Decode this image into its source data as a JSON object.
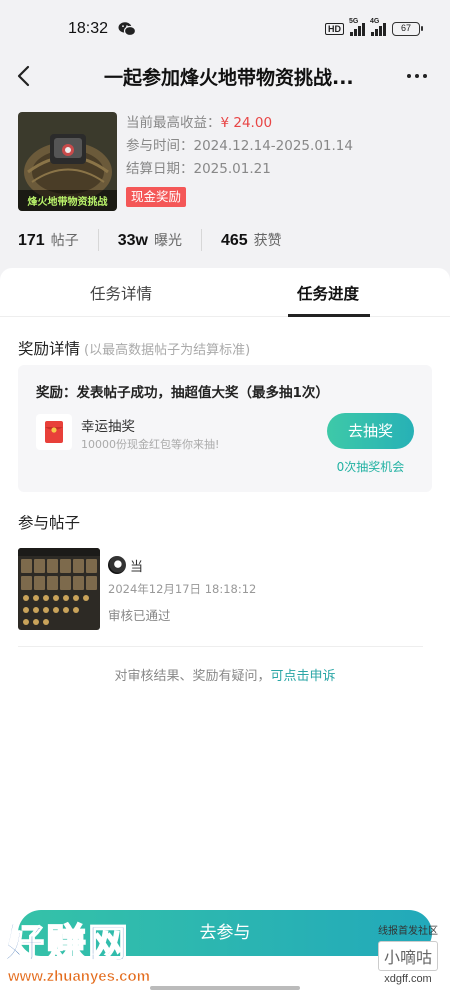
{
  "status_bar": {
    "time": "18:32",
    "hd": "HD",
    "net1": "5G",
    "net2": "4G",
    "battery": "67"
  },
  "nav": {
    "title": "一起参加烽火地带物资挑战..."
  },
  "challenge": {
    "cover_caption": "烽火地带物资挑战",
    "max_income_label": "当前最高收益：",
    "max_income_value": "¥ 24.00",
    "time_label": "参与时间：",
    "time_value": "2024.12.14-2025.01.14",
    "settle_label": "结算日期：",
    "settle_value": "2025.01.21",
    "tag": "现金奖励"
  },
  "stats": [
    {
      "value": "171",
      "label": "帖子"
    },
    {
      "value": "33w",
      "label": "曝光"
    },
    {
      "value": "465",
      "label": "获赞"
    }
  ],
  "tabs": [
    {
      "label": "任务详情",
      "active": false
    },
    {
      "label": "任务进度",
      "active": true
    }
  ],
  "reward": {
    "title": "奖励详情",
    "title_note": "(以最高数据帖子为结算标准)",
    "desc": "奖励：发表帖子成功，抽超值大奖（最多抽1次）",
    "lottery_name": "幸运抽奖",
    "lottery_sub": "10000份现金红包等你来抽!",
    "draw_button": "去抽奖",
    "chances": "0次抽奖机会"
  },
  "posts": {
    "title": "参与帖子",
    "items": [
      {
        "author": "当",
        "date": "2024年12月17日 18:18:12",
        "status": "审核已通过"
      }
    ]
  },
  "appeal": {
    "text": "对审核结果、奖励有疑问，",
    "link": "可点击申诉"
  },
  "join_button": "去参与",
  "watermarks": {
    "left_big": "好赚网",
    "left_url": "www.zhuanyes.com",
    "right_line1": "线报首发社区",
    "right_line2": "小嘀咕",
    "right_line3": "xdgff.com"
  },
  "colors": {
    "accent": "#27b1b6",
    "price": "#e84545",
    "tag": "#f45757"
  }
}
